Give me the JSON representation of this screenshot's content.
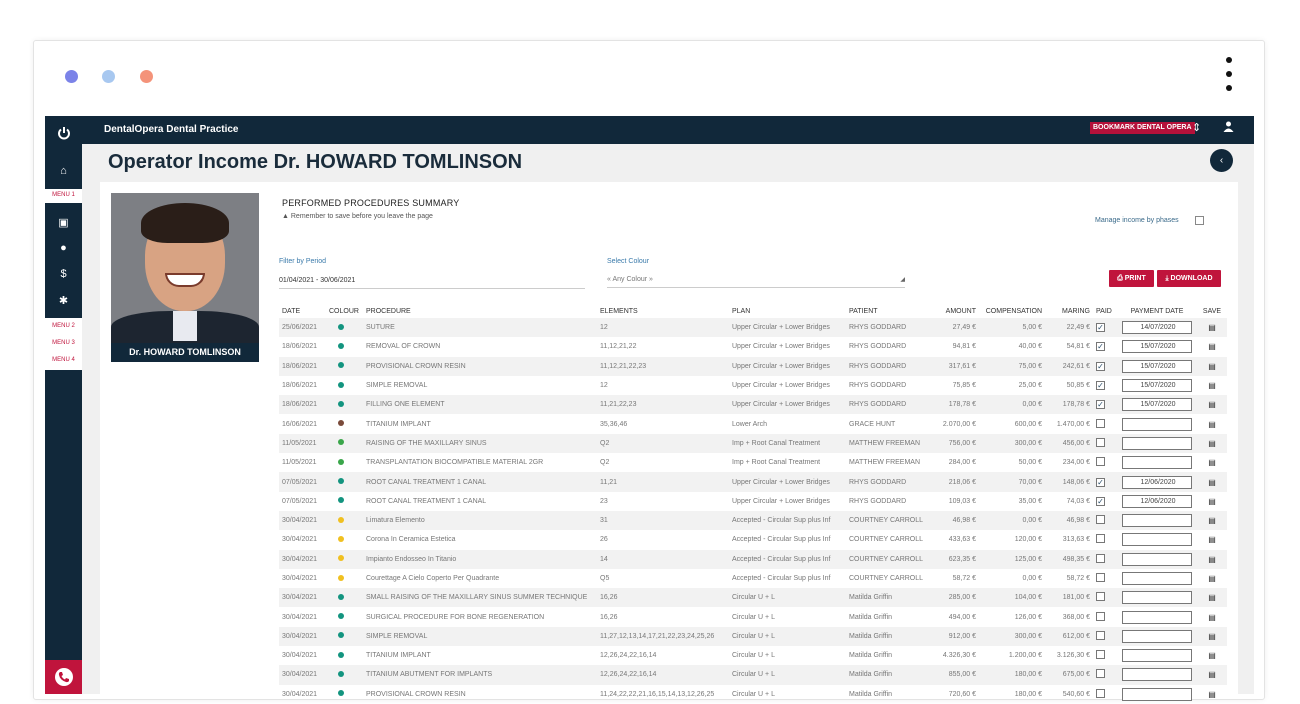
{
  "window": {
    "dot_colors": [
      "#7b83e8",
      "#a8c8f0",
      "#f4937a"
    ]
  },
  "topbar": {
    "brand": "DentalOpera Dental Practice",
    "bookmark": "BOOKMARK DENTAL OPERA"
  },
  "sidebar": {
    "menus": [
      "MENU 1",
      "MENU 2",
      "MENU 3",
      "MENU 4"
    ]
  },
  "page": {
    "title": "Operator Income Dr. HOWARD TOMLINSON"
  },
  "operator": {
    "name": "Dr. HOWARD TOMLINSON"
  },
  "summary": {
    "title": "PERFORMED PROCEDURES SUMMARY",
    "note": "Remember to save before you leave the page",
    "manage_label": "Manage income by phases"
  },
  "filters": {
    "period_label": "Filter by Period",
    "period_value": "01/04/2021 - 30/06/2021",
    "colour_label": "Select Colour",
    "colour_value": "« Any Colour »"
  },
  "actions": {
    "print": "PRINT",
    "download": "DOWNLOAD"
  },
  "table": {
    "headers": [
      "DATE",
      "COLOUR",
      "PROCEDURE",
      "ELEMENTS",
      "PLAN",
      "PATIENT",
      "AMOUNT",
      "COMPENSATION",
      "MARING",
      "PAID",
      "PAYMENT DATE",
      "SAVE"
    ],
    "colors": {
      "teal": "#13947f",
      "brown": "#7a4a3a",
      "green": "#3aa64a",
      "yellow": "#f0c020"
    },
    "rows": [
      {
        "date": "25/06/2021",
        "colour": "teal",
        "procedure": "SUTURE",
        "elements": "12",
        "plan": "Upper Circular + Lower Bridges",
        "patient": "RHYS GODDARD",
        "amount": "27,49 €",
        "compensation": "5,00 €",
        "maring": "22,49 €",
        "paid": true,
        "payment_date": "14/07/2020"
      },
      {
        "date": "18/06/2021",
        "colour": "teal",
        "procedure": "REMOVAL OF CROWN",
        "elements": "11,12,21,22",
        "plan": "Upper Circular + Lower Bridges",
        "patient": "RHYS GODDARD",
        "amount": "94,81 €",
        "compensation": "40,00 €",
        "maring": "54,81 €",
        "paid": true,
        "payment_date": "15/07/2020"
      },
      {
        "date": "18/06/2021",
        "colour": "teal",
        "procedure": "PROVISIONAL CROWN RESIN",
        "elements": "11,12,21,22,23",
        "plan": "Upper Circular + Lower Bridges",
        "patient": "RHYS GODDARD",
        "amount": "317,61 €",
        "compensation": "75,00 €",
        "maring": "242,61 €",
        "paid": true,
        "payment_date": "15/07/2020"
      },
      {
        "date": "18/06/2021",
        "colour": "teal",
        "procedure": "SIMPLE REMOVAL",
        "elements": "12",
        "plan": "Upper Circular + Lower Bridges",
        "patient": "RHYS GODDARD",
        "amount": "75,85 €",
        "compensation": "25,00 €",
        "maring": "50,85 €",
        "paid": true,
        "payment_date": "15/07/2020"
      },
      {
        "date": "18/06/2021",
        "colour": "teal",
        "procedure": "FILLING ONE ELEMENT",
        "elements": "11,21,22,23",
        "plan": "Upper Circular + Lower Bridges",
        "patient": "RHYS GODDARD",
        "amount": "178,78 €",
        "compensation": "0,00 €",
        "maring": "178,78 €",
        "paid": true,
        "payment_date": "15/07/2020"
      },
      {
        "date": "16/06/2021",
        "colour": "brown",
        "procedure": "TITANIUM IMPLANT",
        "elements": "35,36,46",
        "plan": "Lower Arch",
        "patient": "GRACE HUNT",
        "amount": "2.070,00 €",
        "compensation": "600,00 €",
        "maring": "1.470,00 €",
        "paid": false,
        "payment_date": ""
      },
      {
        "date": "11/05/2021",
        "colour": "green",
        "procedure": "RAISING OF THE MAXILLARY SINUS",
        "elements": "Q2",
        "plan": "Imp + Root Canal Treatment",
        "patient": "MATTHEW FREEMAN",
        "amount": "756,00 €",
        "compensation": "300,00 €",
        "maring": "456,00 €",
        "paid": false,
        "payment_date": ""
      },
      {
        "date": "11/05/2021",
        "colour": "green",
        "procedure": "TRANSPLANTATION BIOCOMPATIBLE MATERIAL 2GR",
        "elements": "Q2",
        "plan": "Imp + Root Canal Treatment",
        "patient": "MATTHEW FREEMAN",
        "amount": "284,00 €",
        "compensation": "50,00 €",
        "maring": "234,00 €",
        "paid": false,
        "payment_date": ""
      },
      {
        "date": "07/05/2021",
        "colour": "teal",
        "procedure": "ROOT CANAL TREATMENT 1 CANAL",
        "elements": "11,21",
        "plan": "Upper Circular + Lower Bridges",
        "patient": "RHYS GODDARD",
        "amount": "218,06 €",
        "compensation": "70,00 €",
        "maring": "148,06 €",
        "paid": true,
        "payment_date": "12/06/2020"
      },
      {
        "date": "07/05/2021",
        "colour": "teal",
        "procedure": "ROOT CANAL TREATMENT 1 CANAL",
        "elements": "23",
        "plan": "Upper Circular + Lower Bridges",
        "patient": "RHYS GODDARD",
        "amount": "109,03 €",
        "compensation": "35,00 €",
        "maring": "74,03 €",
        "paid": true,
        "payment_date": "12/06/2020"
      },
      {
        "date": "30/04/2021",
        "colour": "yellow",
        "procedure": "Limatura Elemento",
        "elements": "31",
        "plan": "Accepted - Circular Sup plus Inf",
        "patient": "COURTNEY CARROLL",
        "amount": "46,98 €",
        "compensation": "0,00 €",
        "maring": "46,98 €",
        "paid": false,
        "payment_date": ""
      },
      {
        "date": "30/04/2021",
        "colour": "yellow",
        "procedure": "Corona In Ceramica Estetica",
        "elements": "26",
        "plan": "Accepted - Circular Sup plus Inf",
        "patient": "COURTNEY CARROLL",
        "amount": "433,63 €",
        "compensation": "120,00 €",
        "maring": "313,63 €",
        "paid": false,
        "payment_date": ""
      },
      {
        "date": "30/04/2021",
        "colour": "yellow",
        "procedure": "Impianto Endosseo In Titanio",
        "elements": "14",
        "plan": "Accepted - Circular Sup plus Inf",
        "patient": "COURTNEY CARROLL",
        "amount": "623,35 €",
        "compensation": "125,00 €",
        "maring": "498,35 €",
        "paid": false,
        "payment_date": ""
      },
      {
        "date": "30/04/2021",
        "colour": "yellow",
        "procedure": "Courettage A Cielo Coperto Per Quadrante",
        "elements": "Q5",
        "plan": "Accepted - Circular Sup plus Inf",
        "patient": "COURTNEY CARROLL",
        "amount": "58,72 €",
        "compensation": "0,00 €",
        "maring": "58,72 €",
        "paid": false,
        "payment_date": ""
      },
      {
        "date": "30/04/2021",
        "colour": "teal",
        "procedure": "SMALL RAISING OF THE MAXILLARY SINUS SUMMER TECHNIQUE",
        "elements": "16,26",
        "plan": "Circular U + L",
        "patient": "Matilda Griffin",
        "amount": "285,00 €",
        "compensation": "104,00 €",
        "maring": "181,00 €",
        "paid": false,
        "payment_date": ""
      },
      {
        "date": "30/04/2021",
        "colour": "teal",
        "procedure": "SURGICAL PROCEDURE FOR BONE REGENERATION",
        "elements": "16,26",
        "plan": "Circular U + L",
        "patient": "Matilda Griffin",
        "amount": "494,00 €",
        "compensation": "126,00 €",
        "maring": "368,00 €",
        "paid": false,
        "payment_date": ""
      },
      {
        "date": "30/04/2021",
        "colour": "teal",
        "procedure": "SIMPLE REMOVAL",
        "elements": "11,27,12,13,14,17,21,22,23,24,25,26",
        "plan": "Circular U + L",
        "patient": "Matilda Griffin",
        "amount": "912,00 €",
        "compensation": "300,00 €",
        "maring": "612,00 €",
        "paid": false,
        "payment_date": ""
      },
      {
        "date": "30/04/2021",
        "colour": "teal",
        "procedure": "TITANIUM IMPLANT",
        "elements": "12,26,24,22,16,14",
        "plan": "Circular U + L",
        "patient": "Matilda Griffin",
        "amount": "4.326,30 €",
        "compensation": "1.200,00 €",
        "maring": "3.126,30 €",
        "paid": false,
        "payment_date": ""
      },
      {
        "date": "30/04/2021",
        "colour": "teal",
        "procedure": "TITANIUM ABUTMENT FOR IMPLANTS",
        "elements": "12,26,24,22,16,14",
        "plan": "Circular U + L",
        "patient": "Matilda Griffin",
        "amount": "855,00 €",
        "compensation": "180,00 €",
        "maring": "675,00 €",
        "paid": false,
        "payment_date": ""
      },
      {
        "date": "30/04/2021",
        "colour": "teal",
        "procedure": "PROVISIONAL CROWN RESIN",
        "elements": "11,24,22,22,21,16,15,14,13,12,26,25",
        "plan": "Circular U + L",
        "patient": "Matilda Griffin",
        "amount": "720,60 €",
        "compensation": "180,00 €",
        "maring": "540,60 €",
        "paid": false,
        "payment_date": ""
      }
    ]
  }
}
